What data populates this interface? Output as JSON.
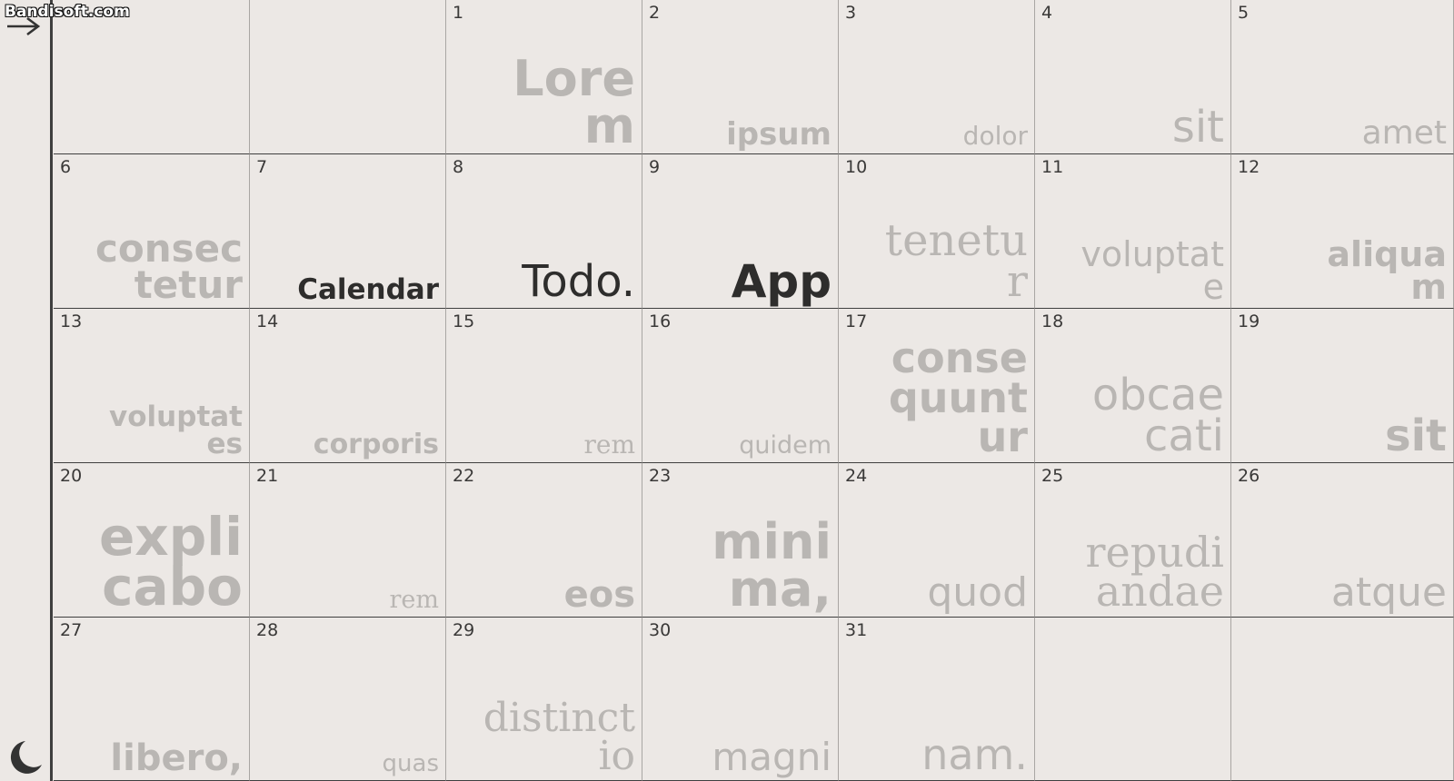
{
  "watermark": "Bandisoft.com",
  "icons": {
    "top": "arrow-right-icon",
    "bottom": "moon-icon"
  },
  "colors": {
    "background": "#ece8e5",
    "muted_text": "#b9b6b3",
    "active_text": "#2e2d2c"
  },
  "calendar": {
    "weeks": [
      [
        {
          "day": "",
          "word": ""
        },
        {
          "day": "",
          "word": ""
        },
        {
          "day": "1",
          "word": "Lorem"
        },
        {
          "day": "2",
          "word": "ipsum"
        },
        {
          "day": "3",
          "word": "dolor"
        },
        {
          "day": "4",
          "word": "sit"
        },
        {
          "day": "5",
          "word": "amet"
        }
      ],
      [
        {
          "day": "6",
          "word": "consectetur"
        },
        {
          "day": "7",
          "word": "Calendar"
        },
        {
          "day": "8",
          "word": "Todo."
        },
        {
          "day": "9",
          "word": "App"
        },
        {
          "day": "10",
          "word": "tenetur"
        },
        {
          "day": "11",
          "word": "voluptate"
        },
        {
          "day": "12",
          "word": "aliquam"
        }
      ],
      [
        {
          "day": "13",
          "word": "voluptates"
        },
        {
          "day": "14",
          "word": "corporis"
        },
        {
          "day": "15",
          "word": "rem"
        },
        {
          "day": "16",
          "word": "quidem"
        },
        {
          "day": "17",
          "word": "consequuntur"
        },
        {
          "day": "18",
          "word": "obcaecati"
        },
        {
          "day": "19",
          "word": "sit"
        }
      ],
      [
        {
          "day": "20",
          "word": "explicabo"
        },
        {
          "day": "21",
          "word": "rem"
        },
        {
          "day": "22",
          "word": "eos"
        },
        {
          "day": "23",
          "word": "minima,"
        },
        {
          "day": "24",
          "word": "quod"
        },
        {
          "day": "25",
          "word": "repudiandae"
        },
        {
          "day": "26",
          "word": "atque"
        }
      ],
      [
        {
          "day": "27",
          "word": "libero,"
        },
        {
          "day": "28",
          "word": "quas"
        },
        {
          "day": "29",
          "word": "distinctio"
        },
        {
          "day": "30",
          "word": "magni"
        },
        {
          "day": "31",
          "word": "nam."
        },
        {
          "day": "",
          "word": ""
        },
        {
          "day": "",
          "word": ""
        }
      ]
    ]
  }
}
